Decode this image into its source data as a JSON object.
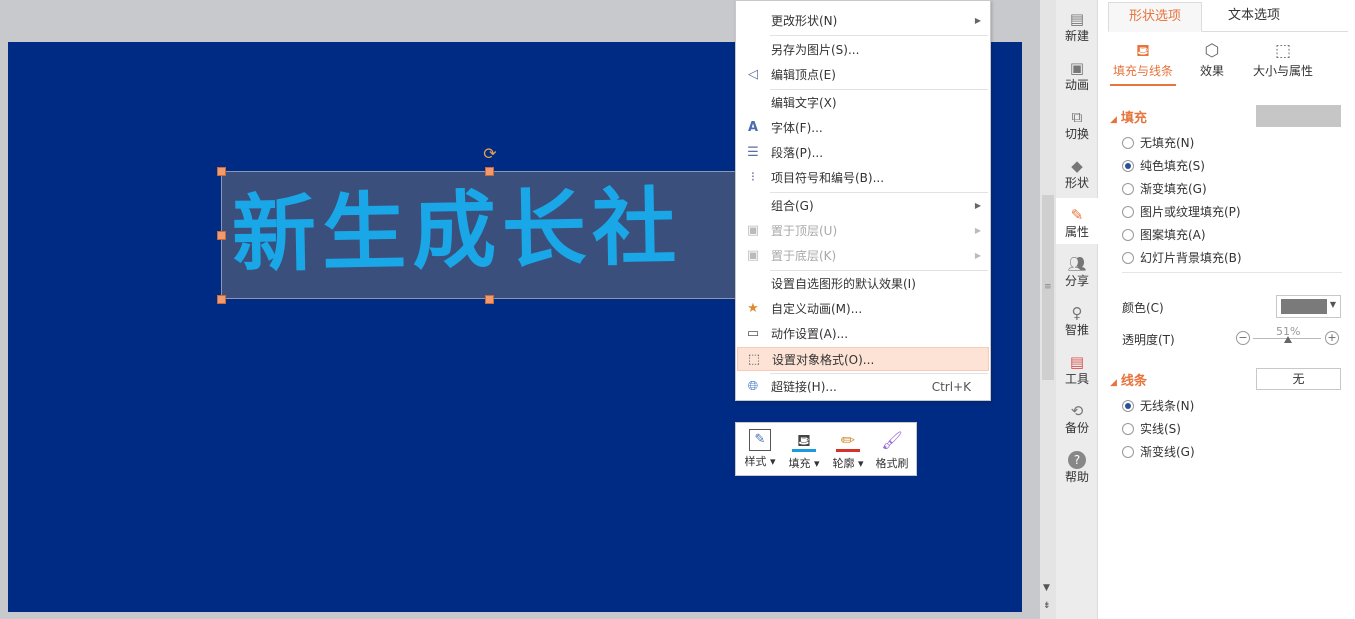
{
  "slide": {
    "shape_text": "新生成长社",
    "colors": {
      "slide_bg": "#002b84",
      "text": "#1aa7e8",
      "shape_fill": "#3b4f7c"
    }
  },
  "context_menu": {
    "items": [
      {
        "label": "更改形状(N)",
        "icon": "",
        "submenu": true,
        "disabled": false,
        "shortcut": ""
      },
      {
        "label": "另存为图片(S)...",
        "icon": "",
        "submenu": false,
        "disabled": false,
        "shortcut": ""
      },
      {
        "label": "编辑顶点(E)",
        "icon": "edit-points-icon",
        "submenu": false,
        "disabled": false,
        "shortcut": ""
      },
      {
        "label": "编辑文字(X)",
        "icon": "",
        "submenu": false,
        "disabled": false,
        "shortcut": ""
      },
      {
        "label": "字体(F)...",
        "icon": "font-icon",
        "submenu": false,
        "disabled": false,
        "shortcut": ""
      },
      {
        "label": "段落(P)...",
        "icon": "paragraph-icon",
        "submenu": false,
        "disabled": false,
        "shortcut": ""
      },
      {
        "label": "项目符号和编号(B)...",
        "icon": "bullets-icon",
        "submenu": false,
        "disabled": false,
        "shortcut": ""
      },
      {
        "label": "组合(G)",
        "icon": "",
        "submenu": true,
        "disabled": false,
        "shortcut": ""
      },
      {
        "label": "置于顶层(U)",
        "icon": "bring-front-icon",
        "submenu": true,
        "disabled": true,
        "shortcut": ""
      },
      {
        "label": "置于底层(K)",
        "icon": "send-back-icon",
        "submenu": true,
        "disabled": true,
        "shortcut": ""
      },
      {
        "label": "设置自选图形的默认效果(I)",
        "icon": "",
        "submenu": false,
        "disabled": false,
        "shortcut": ""
      },
      {
        "label": "自定义动画(M)...",
        "icon": "custom-animation-icon",
        "submenu": false,
        "disabled": false,
        "shortcut": ""
      },
      {
        "label": "动作设置(A)...",
        "icon": "action-settings-icon",
        "submenu": false,
        "disabled": false,
        "shortcut": ""
      },
      {
        "label": "设置对象格式(O)...",
        "icon": "format-object-icon",
        "submenu": false,
        "disabled": false,
        "shortcut": ""
      },
      {
        "label": "超链接(H)...",
        "icon": "hyperlink-icon",
        "submenu": false,
        "disabled": false,
        "shortcut": "Ctrl+K"
      }
    ],
    "highlighted": "设置对象格式(O)..."
  },
  "mini_toolbar": {
    "buttons": [
      {
        "label": "样式",
        "icon": "style-icon"
      },
      {
        "label": "填充",
        "icon": "fill-bucket-icon",
        "bar_color": "#1a9be0"
      },
      {
        "label": "轮廓",
        "icon": "outline-pen-icon",
        "bar_color": "#d6322b"
      },
      {
        "label": "格式刷",
        "icon": "format-painter-icon"
      }
    ]
  },
  "sidebar": {
    "items": [
      {
        "label": "新建",
        "icon": "new-doc-icon"
      },
      {
        "label": "动画",
        "icon": "animation-icon"
      },
      {
        "label": "切换",
        "icon": "transition-icon"
      },
      {
        "label": "形状",
        "icon": "shapes-icon"
      },
      {
        "label": "属性",
        "icon": "properties-icon",
        "active": true
      },
      {
        "label": "分享",
        "icon": "share-icon"
      },
      {
        "label": "智推",
        "icon": "smart-recommend-icon"
      },
      {
        "label": "工具",
        "icon": "toolbox-icon"
      },
      {
        "label": "备份",
        "icon": "backup-icon"
      },
      {
        "label": "帮助",
        "icon": "help-icon"
      }
    ]
  },
  "properties_pane": {
    "tabs": [
      "形状选项",
      "文本选项"
    ],
    "active_tab": "形状选项",
    "subtabs": [
      "填充与线条",
      "效果",
      "大小与属性"
    ],
    "active_subtab": "填充与线条",
    "fill": {
      "title": "填充",
      "options": [
        "无填充(N)",
        "纯色填充(S)",
        "渐变填充(G)",
        "图片或纹理填充(P)",
        "图案填充(A)",
        "幻灯片背景填充(B)"
      ],
      "selected": "纯色填充(S)",
      "swatch_color": "#c6c6c6",
      "color_label": "颜色(C)",
      "color_value": "#7a7a7a",
      "transparency_label": "透明度(T)",
      "transparency_value": "51%",
      "transparency_fraction": 0.51
    },
    "line": {
      "title": "线条",
      "button_label": "无",
      "options": [
        "无线条(N)",
        "实线(S)",
        "渐变线(G)"
      ],
      "selected": "无线条(N)"
    },
    "accent": "#e7743c"
  }
}
